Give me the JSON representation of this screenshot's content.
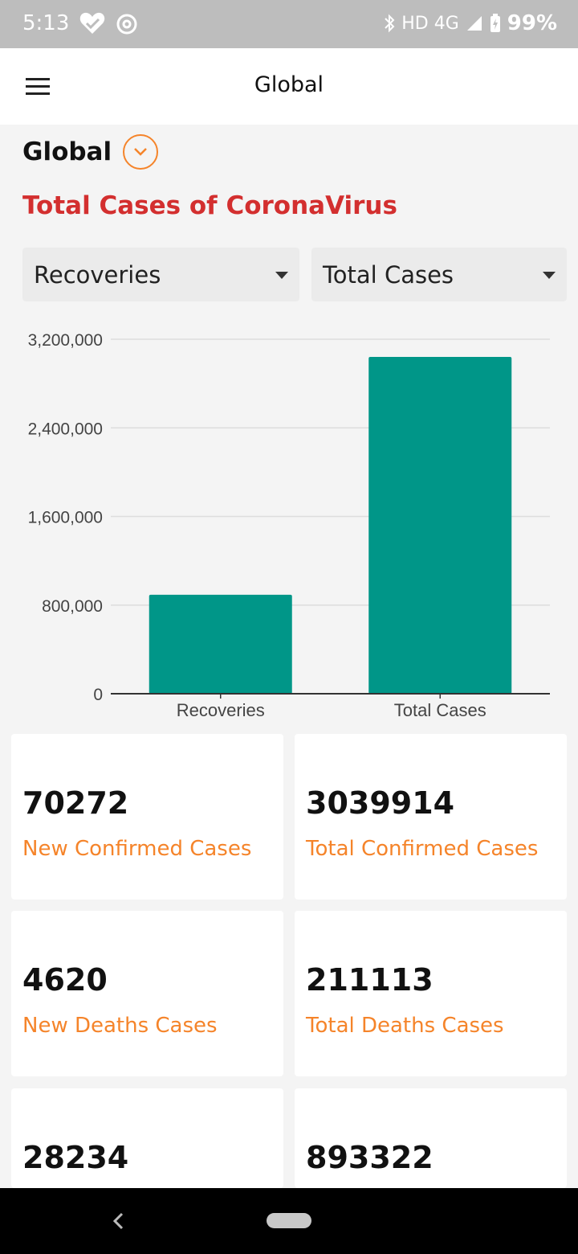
{
  "status_bar": {
    "time": "5:13",
    "network": "HD 4G",
    "battery": "99%",
    "icons": [
      "heart-check-icon",
      "at-sign-icon",
      "bluetooth-icon",
      "signal-icon",
      "battery-charging-icon"
    ]
  },
  "app_bar": {
    "title": "Global",
    "menu_icon": "hamburger-menu-icon"
  },
  "region": {
    "label": "Global",
    "toggle_icon": "chevron-down-circle-icon"
  },
  "section_title": "Total Cases of CoronaVirus",
  "dropdowns": {
    "left": "Recoveries",
    "right": "Total Cases"
  },
  "chart_data": {
    "type": "bar",
    "categories": [
      "Recoveries",
      "Total Cases"
    ],
    "values": [
      893322,
      3039914
    ],
    "ylim": [
      0,
      3200000
    ],
    "yticks": [
      0,
      800000,
      1600000,
      2400000,
      3200000
    ],
    "ytick_labels": [
      "0",
      "800,000",
      "1,600,000",
      "2,400,000",
      "3,200,000"
    ],
    "grid": true,
    "bar_color": "#009688",
    "grid_color": "#dddddd",
    "axis_color": "#333333"
  },
  "cards": [
    {
      "value": "70272",
      "label": "New Confirmed Cases"
    },
    {
      "value": "3039914",
      "label": "Total Confirmed Cases"
    },
    {
      "value": "4620",
      "label": "New Deaths Cases"
    },
    {
      "value": "211113",
      "label": "Total Deaths Cases"
    },
    {
      "value": "28234",
      "label": ""
    },
    {
      "value": "893322",
      "label": ""
    }
  ],
  "colors": {
    "accent": "#f5842a",
    "title_red": "#d32f2f",
    "status_bar": "#bdbdbd"
  },
  "nav_bar": {
    "icons": [
      "back-icon",
      "home-pill-icon"
    ]
  }
}
